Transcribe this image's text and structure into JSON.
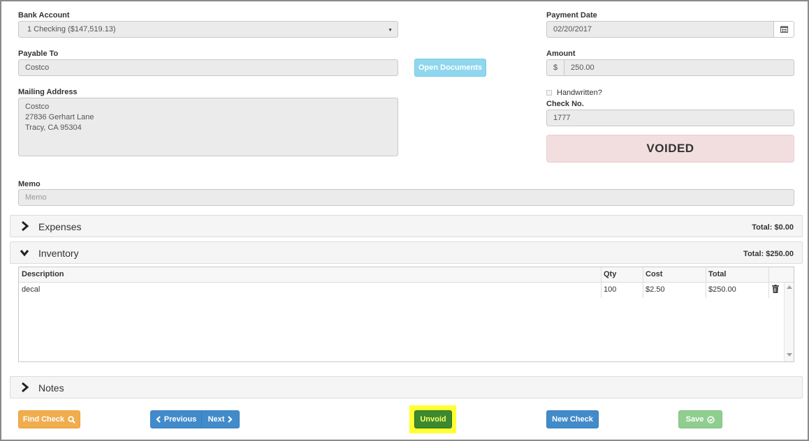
{
  "bank_account": {
    "label": "Bank Account",
    "value": "1 Checking ($147,519.13)"
  },
  "payment_date": {
    "label": "Payment Date",
    "value": "02/20/2017"
  },
  "payable_to": {
    "label": "Payable To",
    "value": "Costco"
  },
  "open_documents_label": "Open Documents",
  "amount": {
    "label": "Amount",
    "currency": "$",
    "value": "250.00"
  },
  "mailing_address": {
    "label": "Mailing Address",
    "line1": "Costco",
    "line2": "27836 Gerhart Lane",
    "line3": "Tracy, CA 95304"
  },
  "handwritten_label": "Handwritten?",
  "check_no": {
    "label": "Check No.",
    "value": "1777"
  },
  "status_banner": "VOIDED",
  "memo": {
    "label": "Memo",
    "placeholder": "Memo"
  },
  "expenses": {
    "title": "Expenses",
    "total": "Total: $0.00",
    "expanded": false
  },
  "inventory": {
    "title": "Inventory",
    "total": "Total: $250.00",
    "expanded": true,
    "columns": {
      "description": "Description",
      "qty": "Qty",
      "cost": "Cost",
      "total": "Total"
    },
    "rows": [
      {
        "description": "decal",
        "qty": "100",
        "cost": "$2.50",
        "total": "$250.00"
      }
    ]
  },
  "notes": {
    "title": "Notes",
    "expanded": false
  },
  "buttons": {
    "find_check": "Find Check",
    "previous": "Previous",
    "next": "Next",
    "unvoid": "Unvoid",
    "new_check": "New Check",
    "save": "Save"
  },
  "colors": {
    "voided_bg": "#f2dede",
    "find_check": "#f0ad4e",
    "primary": "#428bca",
    "unvoid": "#3b8a2f",
    "unvoid_highlight": "#ffff33",
    "save": "#8fce8f",
    "open_documents": "#8fd6ee"
  },
  "icons": [
    "caret-down-icon",
    "calendar-icon",
    "chevron-right-icon",
    "chevron-down-icon",
    "trash-icon",
    "search-icon",
    "chevron-left-icon",
    "check-circle-icon",
    "scroll-up-icon",
    "scroll-down-icon",
    "checkbox-icon"
  ]
}
